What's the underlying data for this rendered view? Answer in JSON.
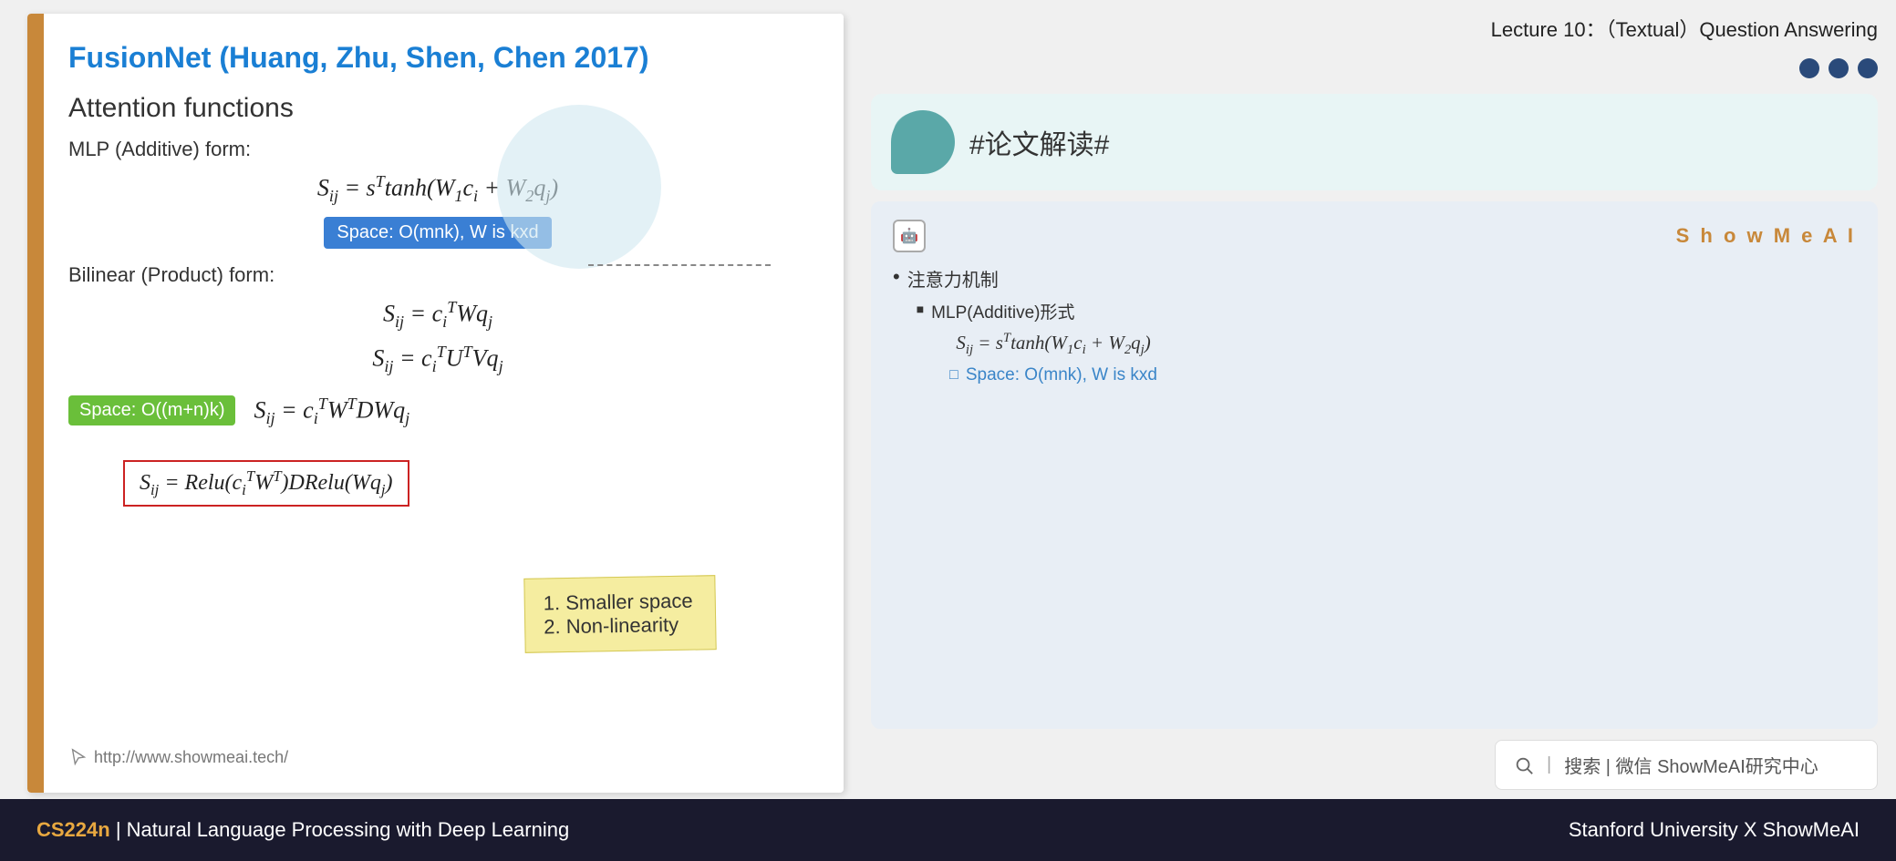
{
  "slide": {
    "title": "FusionNet (Huang, Zhu, Shen, Chen 2017)",
    "subtitle": "Attention functions",
    "mlp_label": "MLP (Additive) form:",
    "mlp_formula": "S_ij = s^T tanh(W_1 c_i + W_2 q_j)",
    "mlp_space": "Space: O(mnk), W is kxd",
    "bilinear_label": "Bilinear (Product) form:",
    "bilinear_f1": "S_ij = c_i^T W q_j",
    "bilinear_f2": "S_ij = c_i^T U^T V q_j",
    "bilinear_f3": "S_ij = c_i^T W^T D W q_j",
    "bilinear_space": "Space: O((m+n)k)",
    "bottom_formula": "S_ij = Relu(c_i^T W^T) D Relu(W q_j)",
    "url": "http://www.showmeai.tech/",
    "note_line1": "1.   Smaller space",
    "note_line2": "2.   Non-linearity"
  },
  "right_panel": {
    "lecture_title": "Lecture 10：（Textual）Question Answering",
    "wechat_tag": "#论文解读#",
    "brand": "ShowMeAI",
    "annotation": {
      "header_icon": "🤖",
      "brand_text": "S h o w M e A I",
      "item1": "注意力机制",
      "subitem1": "MLP(Additive)形式",
      "subformula": "S_ij = s^T tanh(W_1 c_i + W_2 q_j)",
      "subspace": "Space: O(mnk), W is kxd"
    },
    "search_text": "搜索 | 微信 ShowMeAI研究中心"
  },
  "footer": {
    "cs_label": "CS224n",
    "course_name": " | Natural Language Processing with Deep Learning",
    "right_text": "Stanford University  X  ShowMeAI"
  }
}
